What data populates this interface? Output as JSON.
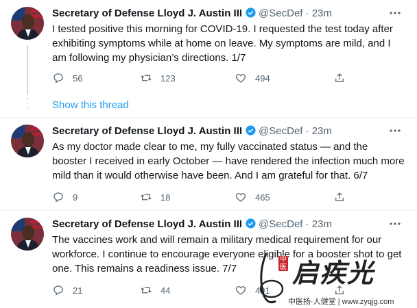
{
  "tweets": [
    {
      "name": "Secretary of Defense Lloyd J. Austin III",
      "handle": "@SecDef",
      "dot": "·",
      "time": "23m",
      "text": "I tested positive this morning for COVID-19. I requested the test today after exhibiting symptoms while at home on leave. My symptoms are mild, and I am following my physician’s directions. 1/7",
      "replies": "56",
      "retweets": "123",
      "likes": "494"
    },
    {
      "name": "Secretary of Defense Lloyd J. Austin III",
      "handle": "@SecDef",
      "dot": "·",
      "time": "23m",
      "text": "As my doctor made clear to me, my fully vaccinated status — and the booster I received in early October — have rendered the infection much more mild than it would otherwise have been. And I am grateful for that. 6/7",
      "replies": "9",
      "retweets": "18",
      "likes": "465"
    },
    {
      "name": "Secretary of Defense Lloyd J. Austin III",
      "handle": "@SecDef",
      "dot": "·",
      "time": "23m",
      "text": "The vaccines work and will remain a military medical requirement for our workforce. I continue to encourage everyone eligible for a booster shot to get one. This remains a readiness issue. 7/7",
      "replies": "21",
      "retweets": "44",
      "likes": "491"
    }
  ],
  "show_thread": "Show this thread",
  "watermark": {
    "seal": "中医",
    "chars": "启疾光",
    "site": "中医扬·人健堂 | www.zyqjg.com"
  },
  "colors": {
    "accent": "#1d9bf0",
    "muted": "#536471",
    "text": "#0f1419"
  },
  "icons": [
    "verified-badge-icon",
    "more-icon",
    "reply-icon",
    "retweet-icon",
    "like-icon",
    "share-icon"
  ]
}
